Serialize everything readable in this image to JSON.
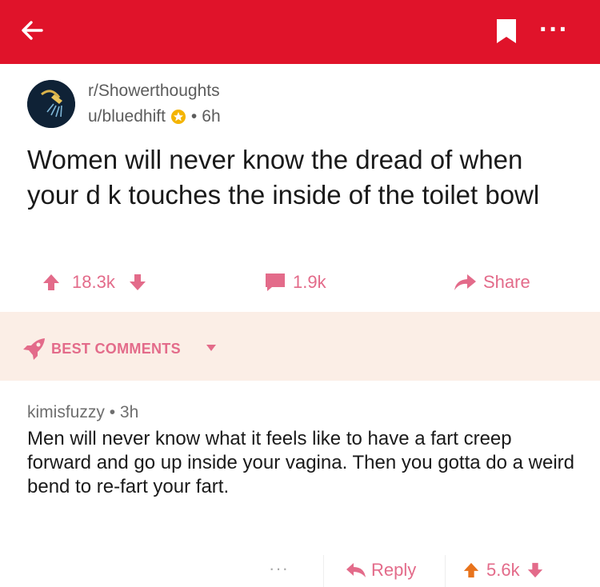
{
  "header": {
    "back_icon": "arrow-left-icon",
    "bookmark_icon": "bookmark-icon",
    "more_icon": "more-horizontal-icon",
    "more_text": "···",
    "background_color": "#e0132a"
  },
  "post": {
    "subreddit": "r/Showerthoughts",
    "author": "u/bluedhift",
    "separator": "•",
    "age": "6h",
    "title": "Women will never know the dread of when your d   k touches the inside of the toilet bowl",
    "upvotes": "18.3k",
    "comments": "1.9k",
    "share_label": "Share"
  },
  "best_comments": {
    "label": "BEST COMMENTS",
    "background_color": "#fbeee6",
    "accent_color": "#e36b8a"
  },
  "comment": {
    "author": "kimisfuzzy",
    "separator": "•",
    "age": "3h",
    "body": "Men will never know what it feels like to have a fart creep forward and go up inside your vagina. Then you gotta do a weird bend to re-fart your fart.",
    "more_text": "···",
    "reply_label": "Reply",
    "score": "5.6k"
  }
}
